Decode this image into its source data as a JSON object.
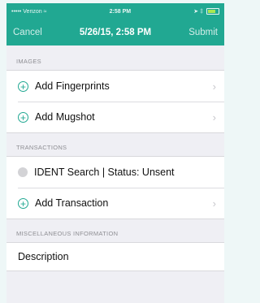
{
  "status_bar": {
    "carrier": "Verizon",
    "time": "2:58 PM",
    "signal_dots": "•••••"
  },
  "nav": {
    "cancel_label": "Cancel",
    "title": "5/26/15, 2:58 PM",
    "submit_label": "Submit"
  },
  "sections": {
    "images": {
      "header": "IMAGES",
      "items": [
        {
          "label": "Add Fingerprints"
        },
        {
          "label": "Add Mugshot"
        }
      ]
    },
    "transactions": {
      "header": "TRANSACTIONS",
      "items": [
        {
          "label": "IDENT Search | Status: Unsent"
        },
        {
          "label": "Add Transaction"
        }
      ]
    },
    "misc": {
      "header": "MISCELLANEOUS INFORMATION",
      "items": [
        {
          "label": "Description"
        }
      ]
    }
  },
  "icons": {
    "plus": "+",
    "chevron": "›"
  },
  "colors": {
    "accent": "#21a892",
    "background": "#efeff4"
  }
}
